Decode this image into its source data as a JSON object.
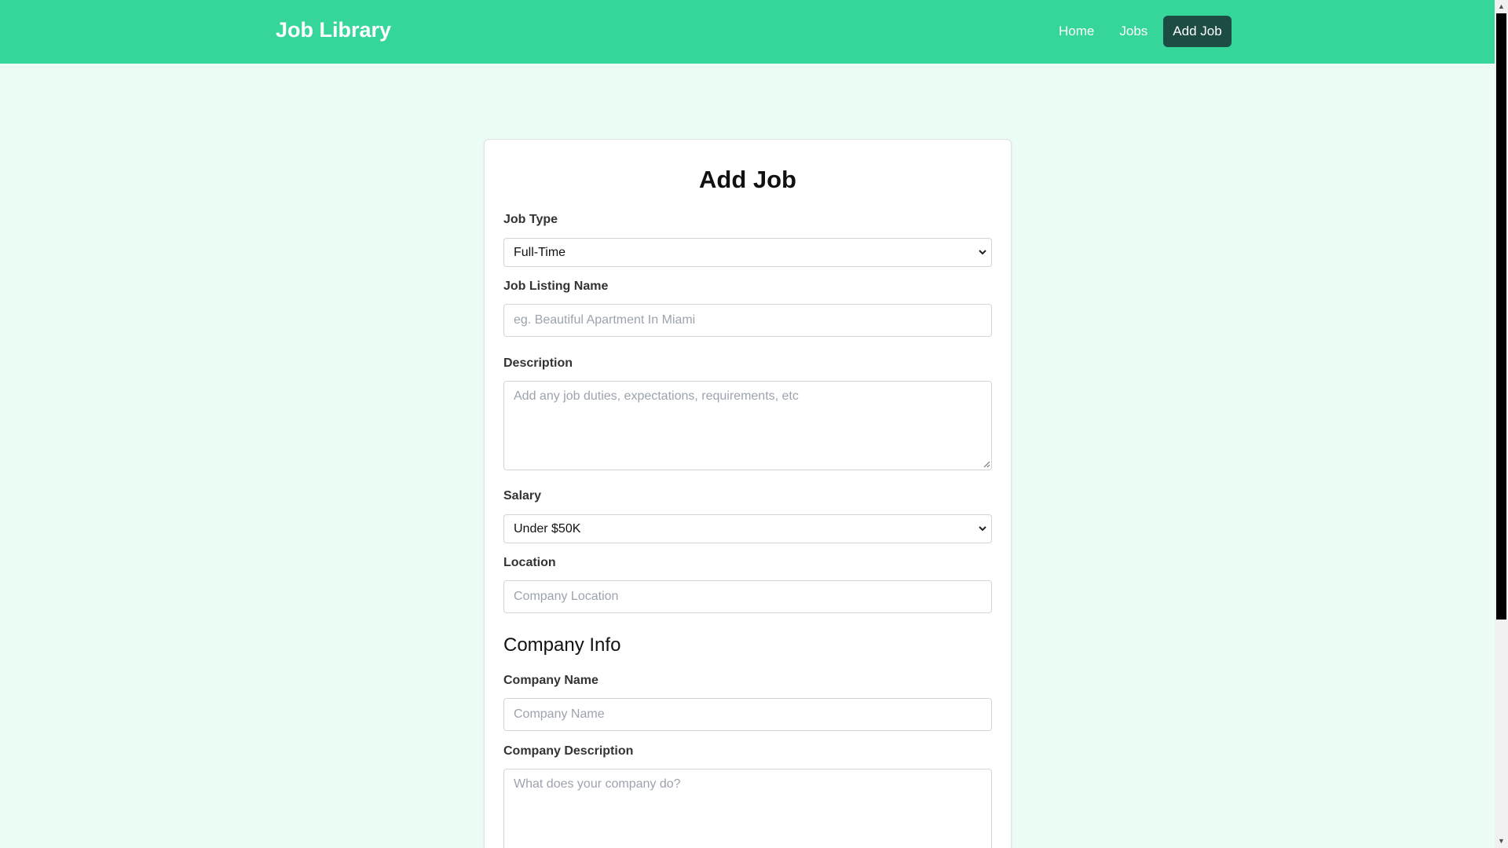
{
  "nav": {
    "brand": "Job Library",
    "links": [
      {
        "label": "Home"
      },
      {
        "label": "Jobs"
      },
      {
        "label": "Add Job"
      }
    ]
  },
  "form": {
    "title": "Add Job",
    "job_type": {
      "label": "Job Type",
      "value": "Full-Time"
    },
    "listing_name": {
      "label": "Job Listing Name",
      "placeholder": "eg. Beautiful Apartment In Miami"
    },
    "description": {
      "label": "Description",
      "placeholder": "Add any job duties, expectations, requirements, etc"
    },
    "salary": {
      "label": "Salary",
      "value": "Under $50K"
    },
    "location": {
      "label": "Location",
      "placeholder": "Company Location"
    },
    "company_section": "Company Info",
    "company_name": {
      "label": "Company Name",
      "placeholder": "Company Name"
    },
    "company_description": {
      "label": "Company Description",
      "placeholder": "What does your company do?"
    }
  },
  "colors": {
    "navbar": "#36d69b",
    "active_link": "#1c4c43",
    "page_background": "#ebfdf5"
  }
}
